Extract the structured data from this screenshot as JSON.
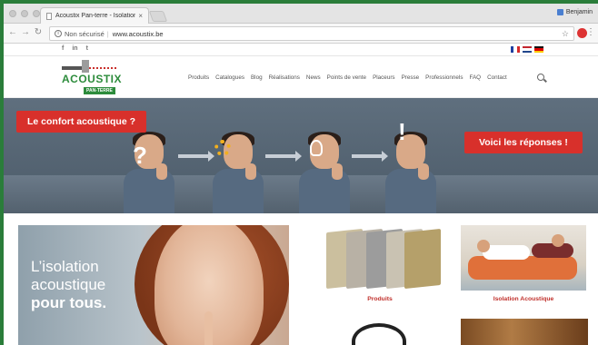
{
  "browser": {
    "tab_title": "Acoustix Pan-terre - Isolation",
    "tab_close": "×",
    "profile_name": "Benjamin",
    "url_prefix": "Non sécurisé",
    "url": "www.acoustix.be"
  },
  "topstrip": {
    "social": [
      "f",
      "in",
      "t"
    ],
    "languages": [
      "FR",
      "NL",
      "DE"
    ]
  },
  "logo": {
    "brand": "ACOUSTIX",
    "sub": "PAN-TERRE",
    "brand_color": "#2d8c3c"
  },
  "nav": {
    "items": [
      "Produits",
      "Catalogues",
      "Blog",
      "Réalisations",
      "News",
      "Points de vente",
      "Placeurs",
      "Presse",
      "Professionnels",
      "FAQ",
      "Contact"
    ]
  },
  "hero": {
    "left_callout": "Le confort acoustique ?",
    "right_callout": "Voici les réponses !",
    "symbols": [
      "?",
      "!"
    ],
    "accent": "#d8302b"
  },
  "feature": {
    "line1": "L’isolation",
    "line2": "acoustique",
    "line3": "pour tous."
  },
  "cards": [
    {
      "title": "Produits"
    },
    {
      "title": "Isolation Acoustique"
    }
  ]
}
